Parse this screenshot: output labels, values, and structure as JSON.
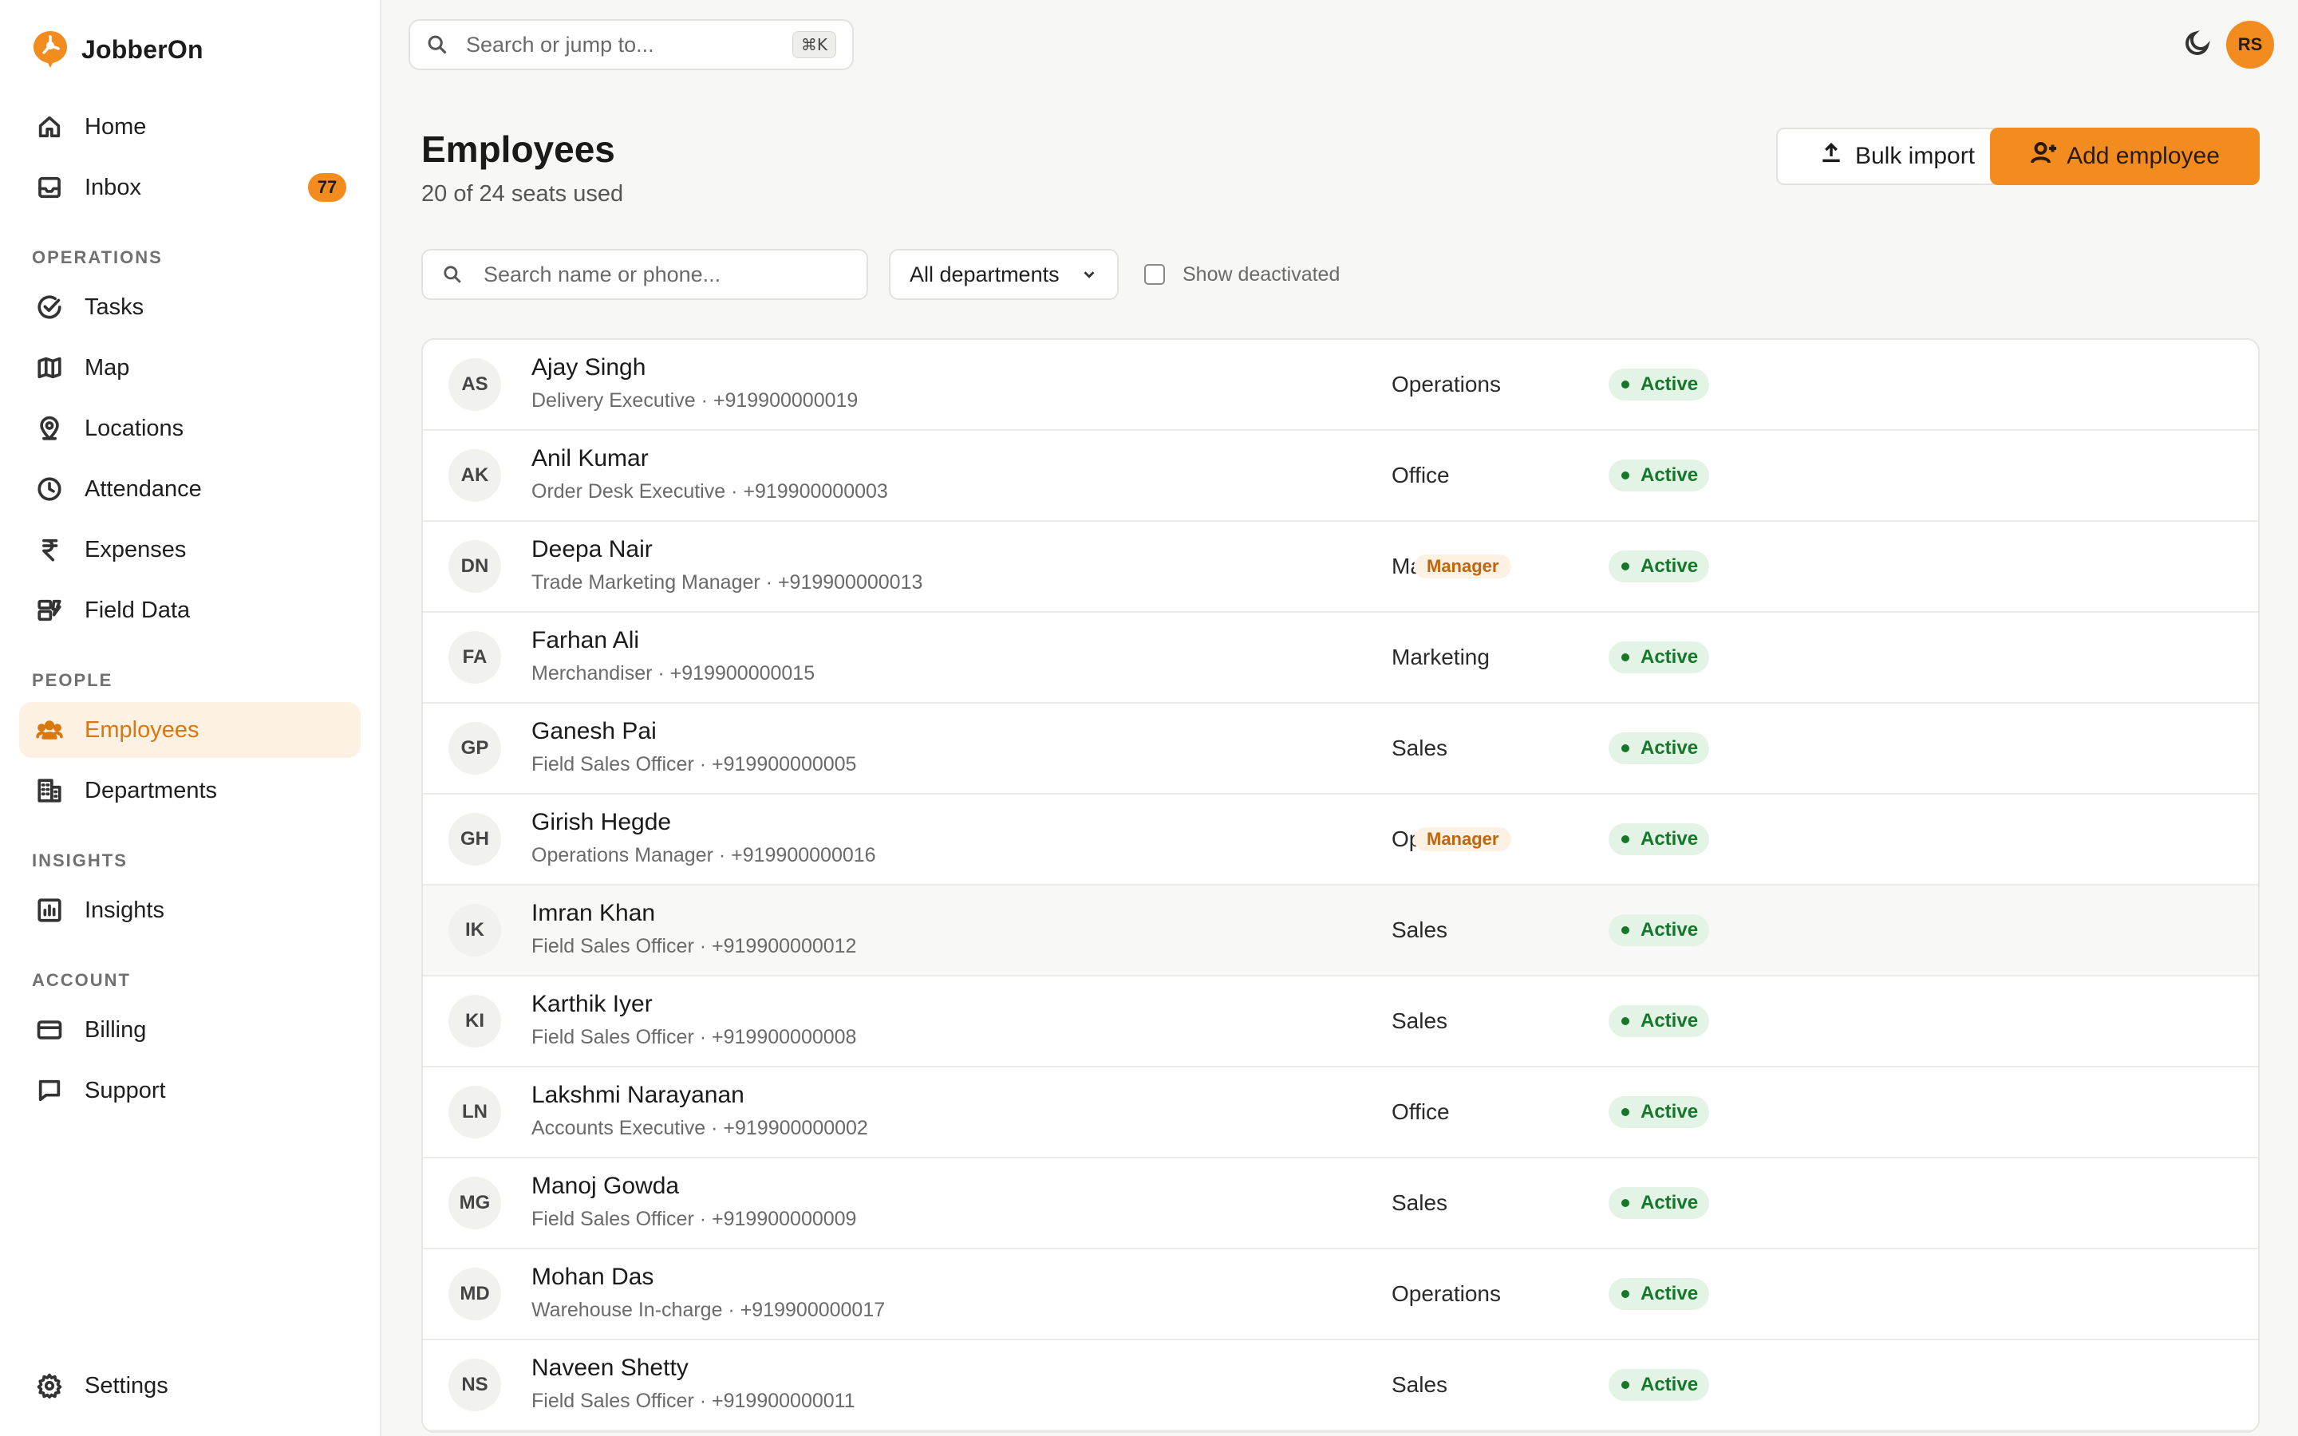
{
  "brand": {
    "name": "JobberOn",
    "accent": "#f28c1e"
  },
  "sidebar": {
    "top_items": [
      {
        "label": "Home",
        "icon": "home-icon"
      },
      {
        "label": "Inbox",
        "icon": "inbox-icon",
        "badge": "77"
      }
    ],
    "sections": [
      {
        "title": "OPERATIONS",
        "items": [
          {
            "label": "Tasks",
            "icon": "check-circle-icon"
          },
          {
            "label": "Map",
            "icon": "map-icon"
          },
          {
            "label": "Locations",
            "icon": "location-pin-icon"
          },
          {
            "label": "Attendance",
            "icon": "clock-icon"
          },
          {
            "label": "Expenses",
            "icon": "rupee-icon"
          },
          {
            "label": "Field Data",
            "icon": "form-icon"
          }
        ]
      },
      {
        "title": "PEOPLE",
        "items": [
          {
            "label": "Employees",
            "icon": "people-icon",
            "active": true
          },
          {
            "label": "Departments",
            "icon": "building-icon"
          }
        ]
      },
      {
        "title": "INSIGHTS",
        "items": [
          {
            "label": "Insights",
            "icon": "bar-chart-icon"
          }
        ]
      },
      {
        "title": "ACCOUNT",
        "items": [
          {
            "label": "Billing",
            "icon": "credit-card-icon"
          },
          {
            "label": "Support",
            "icon": "chat-icon"
          }
        ]
      }
    ],
    "bottom_item": {
      "label": "Settings",
      "icon": "gear-icon"
    }
  },
  "topbar": {
    "search_placeholder": "Search or jump to...",
    "shortcut": "⌘K",
    "user_initials": "RS"
  },
  "page": {
    "title": "Employees",
    "subtitle": "20 of 24 seats used",
    "bulk_import_label": "Bulk import",
    "add_employee_label": "Add employee"
  },
  "filters": {
    "search_placeholder": "Search name or phone...",
    "department_selected": "All departments",
    "show_deactivated_label": "Show deactivated",
    "show_deactivated_checked": false
  },
  "employees": [
    {
      "initials": "AS",
      "name": "Ajay Singh",
      "role": "Delivery Executive",
      "phone": "+919900000019",
      "department": "Operations",
      "manager": "",
      "status": "Active"
    },
    {
      "initials": "AK",
      "name": "Anil Kumar",
      "role": "Order Desk Executive",
      "phone": "+919900000003",
      "department": "Office",
      "manager": "",
      "status": "Active"
    },
    {
      "initials": "DN",
      "name": "Deepa Nair",
      "role": "Trade Marketing Manager",
      "phone": "+919900000013",
      "department": "Marketing",
      "manager": "Manager",
      "status": "Active"
    },
    {
      "initials": "FA",
      "name": "Farhan Ali",
      "role": "Merchandiser",
      "phone": "+919900000015",
      "department": "Marketing",
      "manager": "",
      "status": "Active"
    },
    {
      "initials": "GP",
      "name": "Ganesh Pai",
      "role": "Field Sales Officer",
      "phone": "+919900000005",
      "department": "Sales",
      "manager": "",
      "status": "Active"
    },
    {
      "initials": "GH",
      "name": "Girish Hegde",
      "role": "Operations Manager",
      "phone": "+919900000016",
      "department": "Operations",
      "manager": "Manager",
      "status": "Active"
    },
    {
      "initials": "IK",
      "name": "Imran Khan",
      "role": "Field Sales Officer",
      "phone": "+919900000012",
      "department": "Sales",
      "manager": "",
      "status": "Active"
    },
    {
      "initials": "KI",
      "name": "Karthik Iyer",
      "role": "Field Sales Officer",
      "phone": "+919900000008",
      "department": "Sales",
      "manager": "",
      "status": "Active"
    },
    {
      "initials": "LN",
      "name": "Lakshmi Narayanan",
      "role": "Accounts Executive",
      "phone": "+919900000002",
      "department": "Office",
      "manager": "",
      "status": "Active"
    },
    {
      "initials": "MG",
      "name": "Manoj Gowda",
      "role": "Field Sales Officer",
      "phone": "+919900000009",
      "department": "Sales",
      "manager": "",
      "status": "Active"
    },
    {
      "initials": "MD",
      "name": "Mohan Das",
      "role": "Warehouse In-charge",
      "phone": "+919900000017",
      "department": "Operations",
      "manager": "",
      "status": "Active"
    },
    {
      "initials": "NS",
      "name": "Naveen Shetty",
      "role": "Field Sales Officer",
      "phone": "+919900000011",
      "department": "Sales",
      "manager": "",
      "status": "Active"
    }
  ]
}
